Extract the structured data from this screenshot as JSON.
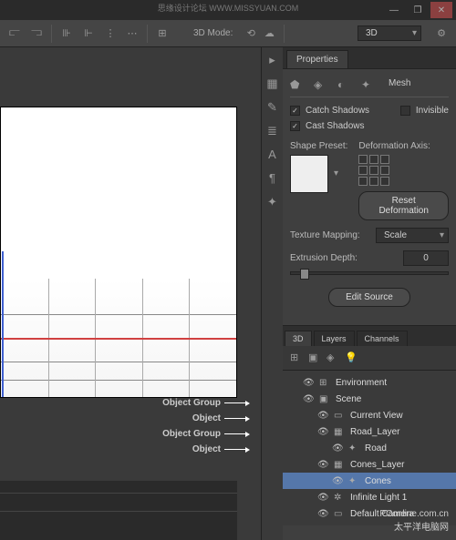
{
  "window": {
    "min": "—",
    "max": "❐",
    "close": "✕"
  },
  "toolbar": {
    "mode_label": "3D Mode:",
    "view_dropdown": "3D"
  },
  "properties": {
    "tab": "Properties",
    "mesh_tab": "Mesh",
    "catch_shadows": "Catch Shadows",
    "invisible": "Invisible",
    "cast_shadows": "Cast Shadows",
    "shape_preset": "Shape Preset:",
    "deformation_axis": "Deformation Axis:",
    "reset_deformation": "Reset Deformation",
    "texture_mapping": "Texture Mapping:",
    "texture_value": "Scale",
    "extrusion_depth": "Extrusion Depth:",
    "extrusion_value": "0",
    "edit_source": "Edit Source"
  },
  "panel3d": {
    "tabs": [
      "3D",
      "Layers",
      "Channels"
    ],
    "items": [
      {
        "label": "Environment",
        "indent": 1,
        "icon": "⊞"
      },
      {
        "label": "Scene",
        "indent": 1,
        "icon": "▣"
      },
      {
        "label": "Current View",
        "indent": 2,
        "icon": "▭"
      },
      {
        "label": "Road_Layer",
        "indent": 2,
        "icon": "▦"
      },
      {
        "label": "Road",
        "indent": 3,
        "icon": "✦"
      },
      {
        "label": "Cones_Layer",
        "indent": 2,
        "icon": "▦"
      },
      {
        "label": "Cones",
        "indent": 3,
        "icon": "✦",
        "sel": true
      },
      {
        "label": "Infinite Light 1",
        "indent": 2,
        "icon": "✲"
      },
      {
        "label": "Default Camera",
        "indent": 2,
        "icon": "▭"
      }
    ]
  },
  "annotations": [
    "Object Group",
    "Object",
    "Object Group",
    "Object"
  ],
  "watermark": {
    "brand": "PConline.com.cn",
    "sub": "太平洋电脑网"
  },
  "watermark_top": "思缘设计论坛  WWW.MISSYUAN.COM"
}
